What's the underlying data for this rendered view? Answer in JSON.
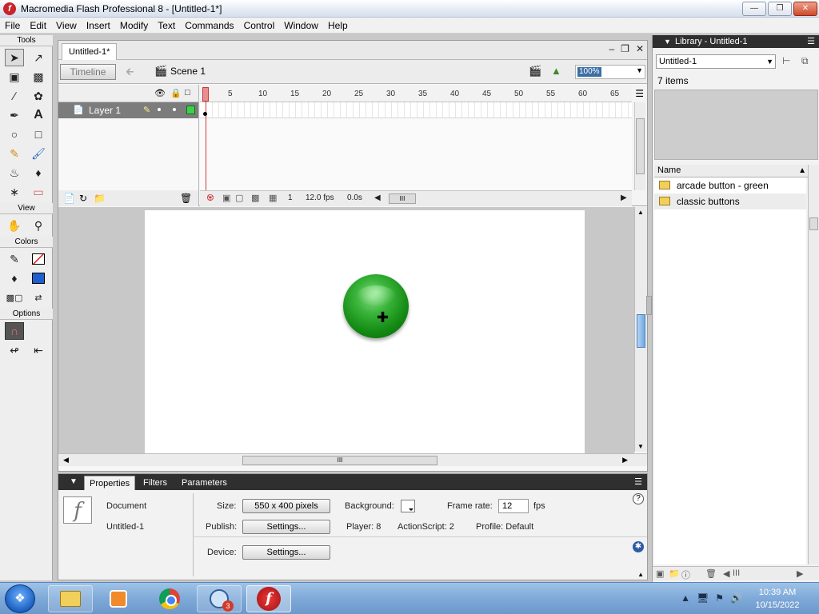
{
  "window": {
    "title": "Macromedia Flash Professional 8 - [Untitled-1*]",
    "minimize": "0",
    "maximize": "1",
    "close": "r"
  },
  "menubar": [
    "File",
    "Edit",
    "View",
    "Insert",
    "Modify",
    "Text",
    "Commands",
    "Control",
    "Window",
    "Help"
  ],
  "tools": {
    "label": "Tools",
    "view_label": "View",
    "colors_label": "Colors",
    "options_label": "Options"
  },
  "document": {
    "tab": "Untitled-1*",
    "timeline_button": "Timeline",
    "scene": "Scene 1",
    "zoom": "100%"
  },
  "timeline": {
    "layer_name": "Layer 1",
    "ruler_ticks": [
      "1",
      "5",
      "10",
      "15",
      "20",
      "25",
      "30",
      "35",
      "40",
      "45",
      "50",
      "55",
      "60",
      "65"
    ],
    "current_frame": "1",
    "fps": "12.0 fps",
    "elapsed": "0.0s",
    "hthumb": "III"
  },
  "properties": {
    "tabs": [
      "Properties",
      "Filters",
      "Parameters"
    ],
    "type": "Document",
    "name": "Untitled-1",
    "size_label": "Size:",
    "size_value": "550 x 400 pixels",
    "background_label": "Background:",
    "background_color": "#ffffff",
    "frame_rate_label": "Frame rate:",
    "frame_rate_value": "12",
    "fps_unit": "fps",
    "publish_label": "Publish:",
    "publish_button": "Settings...",
    "player": "Player: 8",
    "actionscript": "ActionScript: 2",
    "profile": "Profile: Default",
    "device_label": "Device:",
    "device_button": "Settings..."
  },
  "library": {
    "title": "Library - Untitled-1",
    "selected_library": "Untitled-1",
    "count": "7 items",
    "column_name": "Name",
    "items": [
      {
        "name": "arcade button - green"
      },
      {
        "name": "classic buttons"
      }
    ]
  },
  "taskbar": {
    "search_badge": "3",
    "time": "10:39 AM",
    "date": "10/15/2022"
  },
  "colors": {
    "stroke": "#000000",
    "fill": "#1e5fd0",
    "layer_color": "#3ad04a",
    "button_green": "#1e9a1e"
  }
}
